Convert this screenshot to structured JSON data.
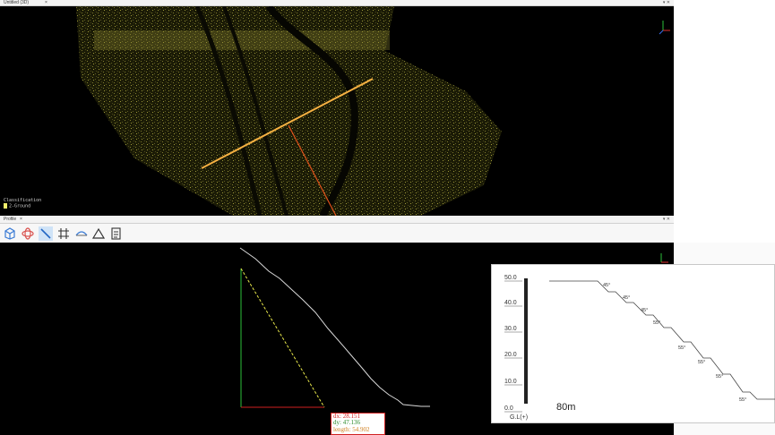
{
  "top_tab": {
    "title": "Untitled (3D)",
    "close": "×"
  },
  "window_controls": "▾ ✕",
  "legend": {
    "title": "Classification",
    "items": [
      {
        "label": "2-Ground",
        "color": "#f2ef6b"
      }
    ]
  },
  "profile_tab": {
    "title": "Profile",
    "close": "×"
  },
  "toolbar": {
    "buttons": [
      {
        "icon": "cube-icon"
      },
      {
        "icon": "orbit-icon"
      },
      {
        "icon": "measure-line-icon",
        "active": true
      },
      {
        "icon": "grid-icon"
      },
      {
        "icon": "section-icon"
      },
      {
        "icon": "angle-icon"
      },
      {
        "icon": "report-icon"
      }
    ]
  },
  "measurement": {
    "dx": "dx: 28.151",
    "dy": "dy: 47.136",
    "length": "length: 54.902"
  },
  "reference_chart": {
    "y_ticks": [
      "50.0",
      "40.0",
      "30.0",
      "20.0",
      "10.0",
      "0.0"
    ],
    "ground_label": "G.L(+)",
    "width_label": "80m",
    "angles": [
      "45°",
      "45°",
      "45°",
      "55°",
      "55°",
      "55°",
      "55°",
      "55°"
    ]
  }
}
